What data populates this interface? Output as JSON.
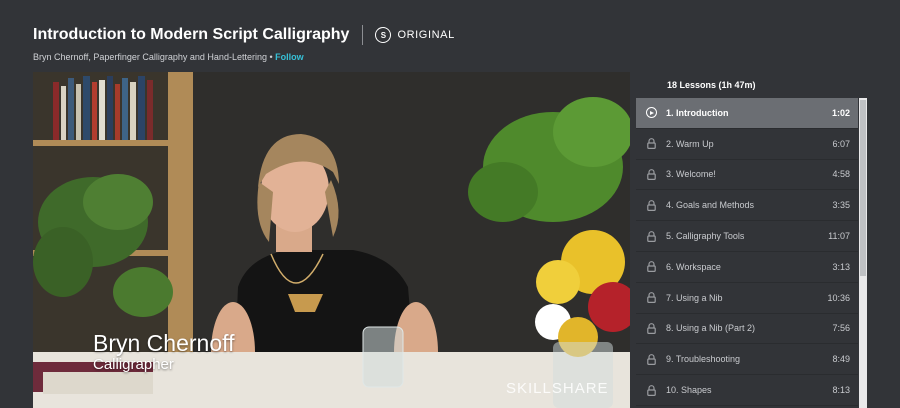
{
  "header": {
    "title": "Introduction to Modern Script Calligraphy",
    "badge_label": "ORIGINAL",
    "instructor": "Bryn Chernoff, Paperfinger Calligraphy and Hand-Lettering",
    "separator": " • ",
    "follow_label": "Follow"
  },
  "video": {
    "lower_third_name": "Bryn Chernoff",
    "lower_third_role": "Calligrapher",
    "watermark": "SKILLSHARE"
  },
  "sidebar": {
    "lessons_summary": "18 Lessons (1h 47m)",
    "lessons": [
      {
        "title": "1. Introduction",
        "duration": "1:02",
        "icon": "play-icon"
      },
      {
        "title": "2. Warm Up",
        "duration": "6:07",
        "icon": "lock-icon"
      },
      {
        "title": "3. Welcome!",
        "duration": "4:58",
        "icon": "lock-icon"
      },
      {
        "title": "4. Goals and Methods",
        "duration": "3:35",
        "icon": "lock-icon"
      },
      {
        "title": "5. Calligraphy Tools",
        "duration": "11:07",
        "icon": "lock-icon"
      },
      {
        "title": "6. Workspace",
        "duration": "3:13",
        "icon": "lock-icon"
      },
      {
        "title": "7. Using a Nib",
        "duration": "10:36",
        "icon": "lock-icon"
      },
      {
        "title": "8. Using a Nib (Part 2)",
        "duration": "7:56",
        "icon": "lock-icon"
      },
      {
        "title": "9. Troubleshooting",
        "duration": "8:49",
        "icon": "lock-icon"
      },
      {
        "title": "10. Shapes",
        "duration": "8:13",
        "icon": "lock-icon"
      }
    ]
  },
  "colors": {
    "background": "#323438",
    "accent": "#36c0d6",
    "active_row": "#6b6e73"
  }
}
